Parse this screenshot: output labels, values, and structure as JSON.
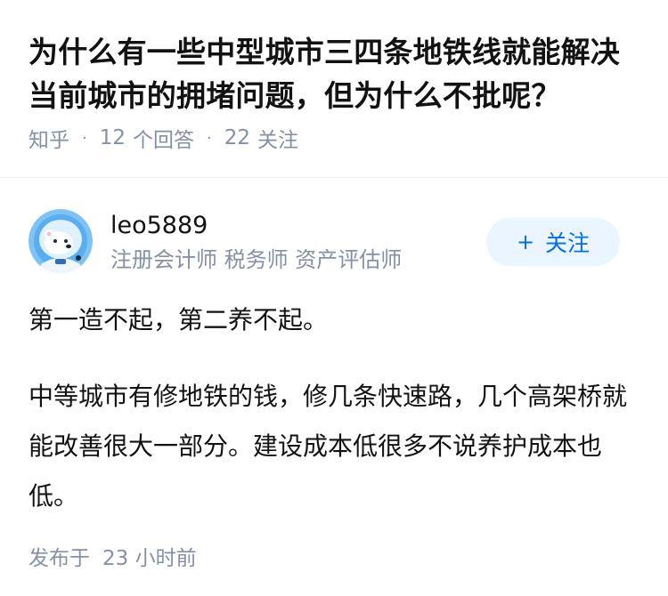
{
  "question": {
    "title": "为什么有一些中型城市三四条地铁线就能解决当前城市的拥堵问题，但为什么不批呢？",
    "source": "知乎",
    "separator": "·",
    "answers_count": "12",
    "answers_label": "个回答",
    "followers_count": "22",
    "followers_label": "关注"
  },
  "answer": {
    "author": {
      "name": "leo5889",
      "bio": "注册会计师 税务师 资产评估师",
      "avatar_icon": "polar-bear-astronaut-avatar"
    },
    "follow_button": {
      "icon": "plus-icon",
      "plus": "+",
      "label": "关注"
    },
    "paragraphs": [
      "第一造不起，第二养不起。",
      "中等城市有修地铁的钱，修几条快速路，几个高架桥就能改善很大一部分。建设成本低很多不说养护成本也低。"
    ],
    "published_label": "发布于",
    "published_time": "23 小时前"
  },
  "colors": {
    "accent": "#056de8",
    "accent_bg": "#ebf5ff",
    "meta_gray": "#8590a6",
    "text": "#121212"
  }
}
